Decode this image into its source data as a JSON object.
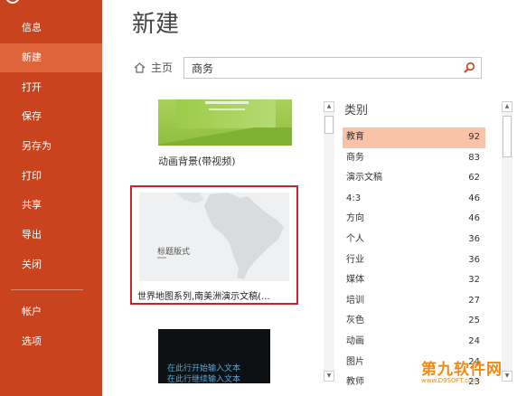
{
  "sidebar": {
    "items": [
      {
        "label": "信息"
      },
      {
        "label": "新建"
      },
      {
        "label": "打开"
      },
      {
        "label": "保存"
      },
      {
        "label": "另存为"
      },
      {
        "label": "打印"
      },
      {
        "label": "共享"
      },
      {
        "label": "导出"
      },
      {
        "label": "关闭"
      },
      {
        "label": "帐户"
      },
      {
        "label": "选项"
      }
    ]
  },
  "main": {
    "title": "新建",
    "home_label": "主页",
    "search": {
      "value": "商务"
    },
    "templates": [
      {
        "label": "动画背景(带视频)"
      },
      {
        "label": "世界地图系列,南美洲演示文稿(...",
        "thumb_title": "标题版式"
      },
      {
        "thumb_line1": "在此行开始输入文本",
        "thumb_line2": "在此行继续输入文本"
      }
    ]
  },
  "categories": {
    "header": "类别",
    "items": [
      {
        "name": "教育",
        "count": "92",
        "selected": true
      },
      {
        "name": "商务",
        "count": "83"
      },
      {
        "name": "演示文稿",
        "count": "62"
      },
      {
        "name": "4:3",
        "count": "46"
      },
      {
        "name": "方向",
        "count": "46"
      },
      {
        "name": "个人",
        "count": "36"
      },
      {
        "name": "行业",
        "count": "36"
      },
      {
        "name": "媒体",
        "count": "32"
      },
      {
        "name": "培训",
        "count": "27"
      },
      {
        "name": "灰色",
        "count": "25"
      },
      {
        "name": "动画",
        "count": "24"
      },
      {
        "name": "图片",
        "count": "24"
      },
      {
        "name": "教师",
        "count": "23"
      }
    ]
  },
  "watermark": {
    "text": "第九软件网",
    "url": "www.D9SOFT.com"
  },
  "colors": {
    "sidebar": "#c9441e",
    "sidebar_active": "#e0643b",
    "selection": "#c6242d",
    "category_selected": "#f9c3aa"
  }
}
